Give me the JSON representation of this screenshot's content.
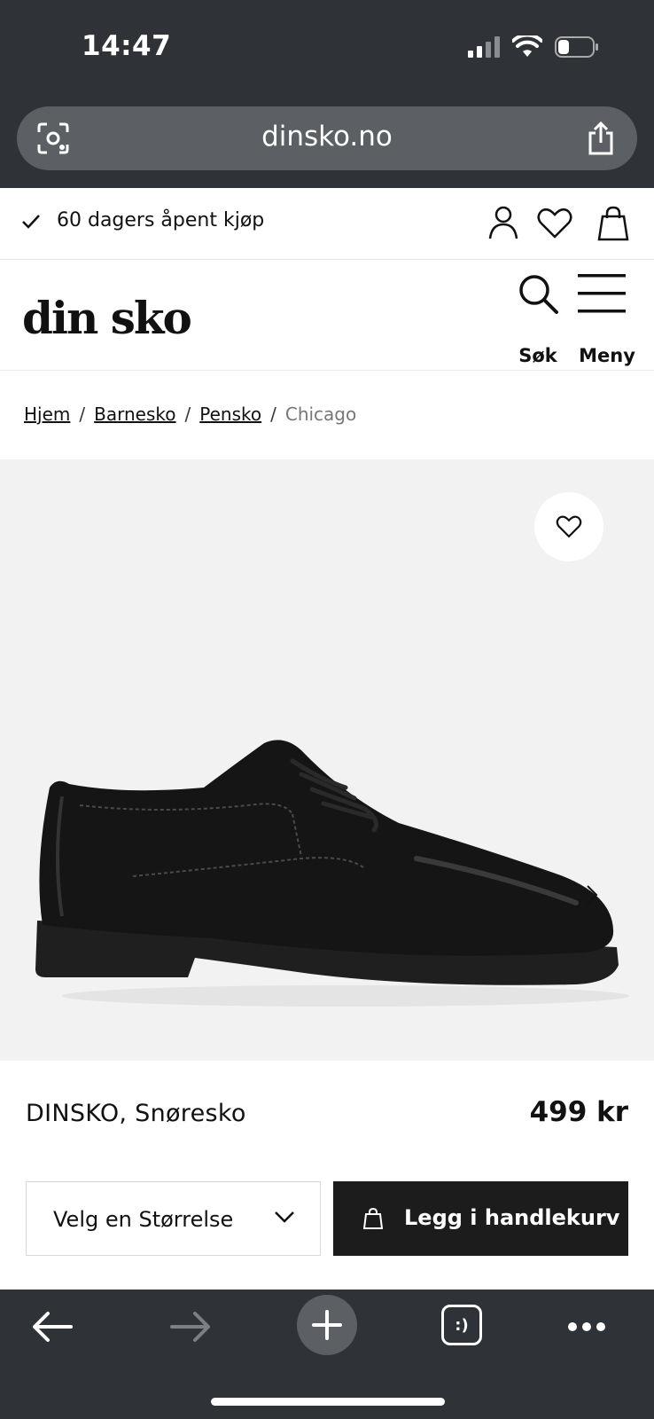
{
  "status_bar": {
    "time": "14:47"
  },
  "browser": {
    "url": "dinsko.no"
  },
  "promo": {
    "text": "60 dagers åpent kjøp"
  },
  "header": {
    "logo": "din sko",
    "search_label": "Søk",
    "menu_label": "Meny"
  },
  "breadcrumb": {
    "items": [
      "Hjem",
      "Barnesko",
      "Pensko"
    ],
    "current": "Chicago",
    "separator": "/"
  },
  "product": {
    "name": "DINSKO, Snøresko",
    "price": "499 kr",
    "size_select_label": "Velg en Størrelse",
    "add_to_cart_label": "Legg i handlekurv"
  },
  "toolbar": {
    "tabs_label": ":)"
  },
  "colors": {
    "chrome": "#2f3236",
    "urlbar": "#5c6064",
    "cta": "#1c1c1c",
    "gallery_bg": "#f2f2f2"
  },
  "icons": [
    "scan-icon",
    "share-icon",
    "check-icon",
    "account-icon",
    "heart-icon",
    "bag-icon",
    "search-icon",
    "hamburger-icon",
    "chevron-right-icon",
    "chevron-down-icon",
    "back-arrow-icon",
    "forward-arrow-icon",
    "plus-icon",
    "more-icon"
  ]
}
